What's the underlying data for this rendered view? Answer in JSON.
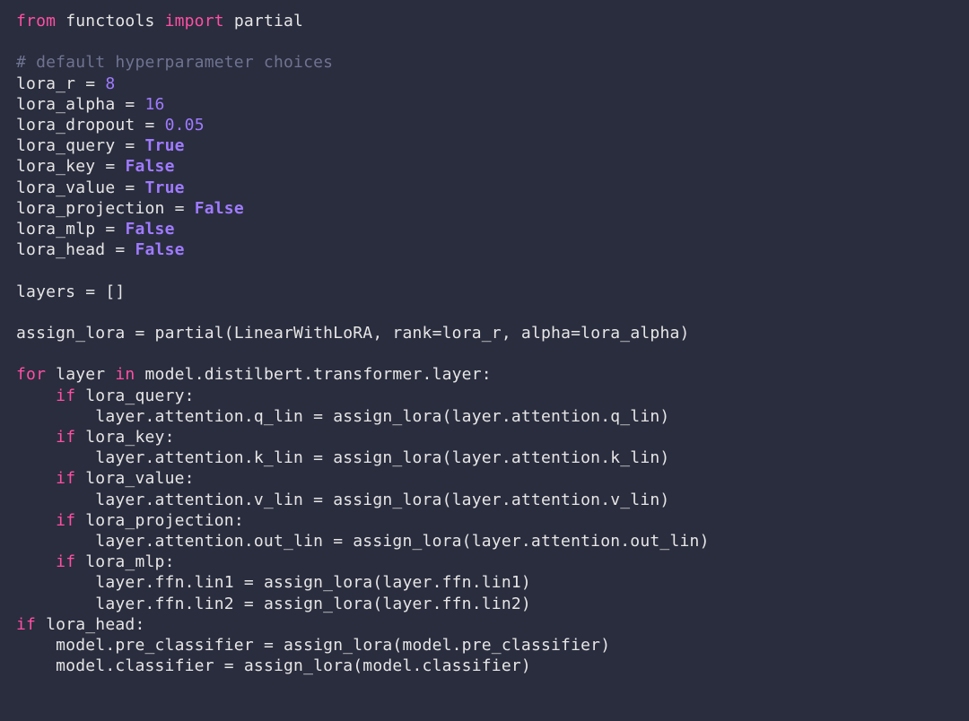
{
  "code": {
    "lines": [
      [
        {
          "cls": "tok-kw",
          "t": "from"
        },
        {
          "cls": "tok-ident",
          "t": " functools "
        },
        {
          "cls": "tok-kw",
          "t": "import"
        },
        {
          "cls": "tok-ident",
          "t": " partial"
        }
      ],
      [],
      [
        {
          "cls": "tok-cmt",
          "t": "# default hyperparameter choices"
        }
      ],
      [
        {
          "cls": "tok-ident",
          "t": "lora_r "
        },
        {
          "cls": "tok-op",
          "t": "="
        },
        {
          "cls": "tok-ident",
          "t": " "
        },
        {
          "cls": "tok-num",
          "t": "8"
        }
      ],
      [
        {
          "cls": "tok-ident",
          "t": "lora_alpha "
        },
        {
          "cls": "tok-op",
          "t": "="
        },
        {
          "cls": "tok-ident",
          "t": " "
        },
        {
          "cls": "tok-num",
          "t": "16"
        }
      ],
      [
        {
          "cls": "tok-ident",
          "t": "lora_dropout "
        },
        {
          "cls": "tok-op",
          "t": "="
        },
        {
          "cls": "tok-ident",
          "t": " "
        },
        {
          "cls": "tok-num",
          "t": "0.05"
        }
      ],
      [
        {
          "cls": "tok-ident",
          "t": "lora_query "
        },
        {
          "cls": "tok-op",
          "t": "="
        },
        {
          "cls": "tok-ident",
          "t": " "
        },
        {
          "cls": "tok-bool",
          "t": "True"
        }
      ],
      [
        {
          "cls": "tok-ident",
          "t": "lora_key "
        },
        {
          "cls": "tok-op",
          "t": "="
        },
        {
          "cls": "tok-ident",
          "t": " "
        },
        {
          "cls": "tok-bool",
          "t": "False"
        }
      ],
      [
        {
          "cls": "tok-ident",
          "t": "lora_value "
        },
        {
          "cls": "tok-op",
          "t": "="
        },
        {
          "cls": "tok-ident",
          "t": " "
        },
        {
          "cls": "tok-bool",
          "t": "True"
        }
      ],
      [
        {
          "cls": "tok-ident",
          "t": "lora_projection "
        },
        {
          "cls": "tok-op",
          "t": "="
        },
        {
          "cls": "tok-ident",
          "t": " "
        },
        {
          "cls": "tok-bool",
          "t": "False"
        }
      ],
      [
        {
          "cls": "tok-ident",
          "t": "lora_mlp "
        },
        {
          "cls": "tok-op",
          "t": "="
        },
        {
          "cls": "tok-ident",
          "t": " "
        },
        {
          "cls": "tok-bool",
          "t": "False"
        }
      ],
      [
        {
          "cls": "tok-ident",
          "t": "lora_head "
        },
        {
          "cls": "tok-op",
          "t": "="
        },
        {
          "cls": "tok-ident",
          "t": " "
        },
        {
          "cls": "tok-bool",
          "t": "False"
        }
      ],
      [],
      [
        {
          "cls": "tok-ident",
          "t": "layers "
        },
        {
          "cls": "tok-op",
          "t": "="
        },
        {
          "cls": "tok-ident",
          "t": " "
        },
        {
          "cls": "tok-punct",
          "t": "[]"
        }
      ],
      [],
      [
        {
          "cls": "tok-ident",
          "t": "assign_lora "
        },
        {
          "cls": "tok-op",
          "t": "="
        },
        {
          "cls": "tok-ident",
          "t": " partial(LinearWithLoRA, rank"
        },
        {
          "cls": "tok-op",
          "t": "="
        },
        {
          "cls": "tok-ident",
          "t": "lora_r, alpha"
        },
        {
          "cls": "tok-op",
          "t": "="
        },
        {
          "cls": "tok-ident",
          "t": "lora_alpha)"
        }
      ],
      [],
      [
        {
          "cls": "tok-kw",
          "t": "for"
        },
        {
          "cls": "tok-ident",
          "t": " layer "
        },
        {
          "cls": "tok-kw",
          "t": "in"
        },
        {
          "cls": "tok-ident",
          "t": " model.distilbert.transformer.layer:"
        }
      ],
      [
        {
          "cls": "tok-ident",
          "t": "    "
        },
        {
          "cls": "tok-kw",
          "t": "if"
        },
        {
          "cls": "tok-ident",
          "t": " lora_query:"
        }
      ],
      [
        {
          "cls": "tok-ident",
          "t": "        layer.attention.q_lin "
        },
        {
          "cls": "tok-op",
          "t": "="
        },
        {
          "cls": "tok-ident",
          "t": " assign_lora(layer.attention.q_lin)"
        }
      ],
      [
        {
          "cls": "tok-ident",
          "t": "    "
        },
        {
          "cls": "tok-kw",
          "t": "if"
        },
        {
          "cls": "tok-ident",
          "t": " lora_key:"
        }
      ],
      [
        {
          "cls": "tok-ident",
          "t": "        layer.attention.k_lin "
        },
        {
          "cls": "tok-op",
          "t": "="
        },
        {
          "cls": "tok-ident",
          "t": " assign_lora(layer.attention.k_lin)"
        }
      ],
      [
        {
          "cls": "tok-ident",
          "t": "    "
        },
        {
          "cls": "tok-kw",
          "t": "if"
        },
        {
          "cls": "tok-ident",
          "t": " lora_value:"
        }
      ],
      [
        {
          "cls": "tok-ident",
          "t": "        layer.attention.v_lin "
        },
        {
          "cls": "tok-op",
          "t": "="
        },
        {
          "cls": "tok-ident",
          "t": " assign_lora(layer.attention.v_lin)"
        }
      ],
      [
        {
          "cls": "tok-ident",
          "t": "    "
        },
        {
          "cls": "tok-kw",
          "t": "if"
        },
        {
          "cls": "tok-ident",
          "t": " lora_projection:"
        }
      ],
      [
        {
          "cls": "tok-ident",
          "t": "        layer.attention.out_lin "
        },
        {
          "cls": "tok-op",
          "t": "="
        },
        {
          "cls": "tok-ident",
          "t": " assign_lora(layer.attention.out_lin)"
        }
      ],
      [
        {
          "cls": "tok-ident",
          "t": "    "
        },
        {
          "cls": "tok-kw",
          "t": "if"
        },
        {
          "cls": "tok-ident",
          "t": " lora_mlp:"
        }
      ],
      [
        {
          "cls": "tok-ident",
          "t": "        layer.ffn.lin1 "
        },
        {
          "cls": "tok-op",
          "t": "="
        },
        {
          "cls": "tok-ident",
          "t": " assign_lora(layer.ffn.lin1)"
        }
      ],
      [
        {
          "cls": "tok-ident",
          "t": "        layer.ffn.lin2 "
        },
        {
          "cls": "tok-op",
          "t": "="
        },
        {
          "cls": "tok-ident",
          "t": " assign_lora(layer.ffn.lin2)"
        }
      ],
      [
        {
          "cls": "tok-kw",
          "t": "if"
        },
        {
          "cls": "tok-ident",
          "t": " lora_head:"
        }
      ],
      [
        {
          "cls": "tok-ident",
          "t": "    model.pre_classifier "
        },
        {
          "cls": "tok-op",
          "t": "="
        },
        {
          "cls": "tok-ident",
          "t": " assign_lora(model.pre_classifier)"
        }
      ],
      [
        {
          "cls": "tok-ident",
          "t": "    model.classifier "
        },
        {
          "cls": "tok-op",
          "t": "="
        },
        {
          "cls": "tok-ident",
          "t": " assign_lora(model.classifier)"
        }
      ]
    ]
  }
}
